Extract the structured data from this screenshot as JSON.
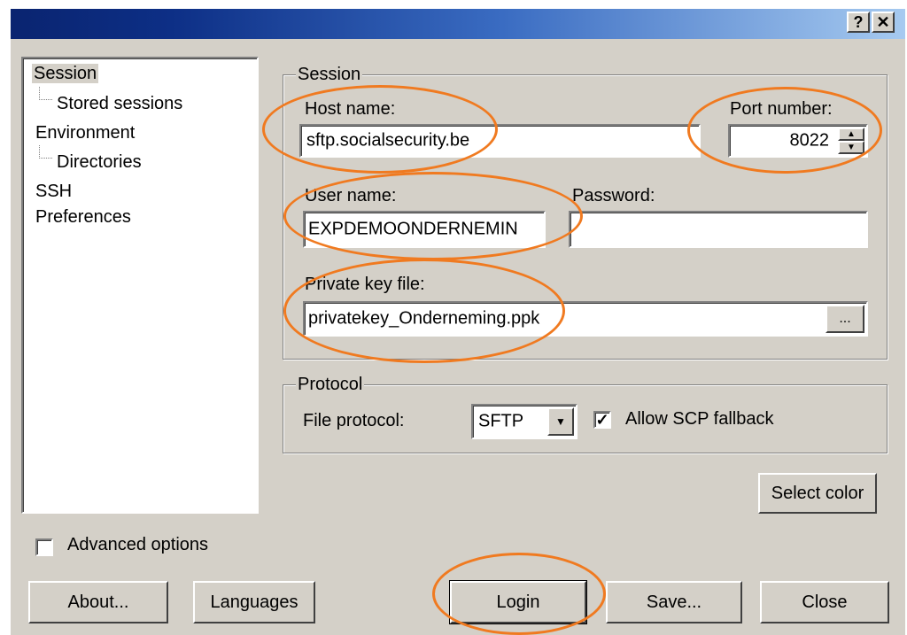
{
  "titlebar": {
    "help_label": "?",
    "close_label": "✕"
  },
  "tree": {
    "items": [
      {
        "label": "Session",
        "selected": true
      },
      {
        "label": "Stored sessions"
      },
      {
        "label": "Environment"
      },
      {
        "label": "Directories"
      },
      {
        "label": "SSH"
      },
      {
        "label": "Preferences"
      }
    ]
  },
  "session": {
    "group_label": "Session",
    "host_label": "Host name:",
    "host_value": "sftp.socialsecurity.be",
    "port_label": "Port number:",
    "port_value": "8022",
    "user_label": "User name:",
    "user_value": "EXPDEMOONDERNEMIN",
    "password_label": "Password:",
    "password_value": "",
    "key_label": "Private key file:",
    "key_value": "privatekey_Onderneming.ppk",
    "browse_label": "..."
  },
  "protocol": {
    "group_label": "Protocol",
    "file_protocol_label": "File protocol:",
    "file_protocol_value": "SFTP",
    "scp_fallback_label": "Allow SCP fallback",
    "scp_fallback_checked": true
  },
  "select_color_label": "Select color",
  "advanced_options_label": "Advanced options",
  "buttons": {
    "about": "About...",
    "languages": "Languages",
    "login": "Login",
    "save": "Save...",
    "close": "Close"
  },
  "colors": {
    "highlight": "#f07a20",
    "dialog_bg": "#d4d0c8"
  }
}
